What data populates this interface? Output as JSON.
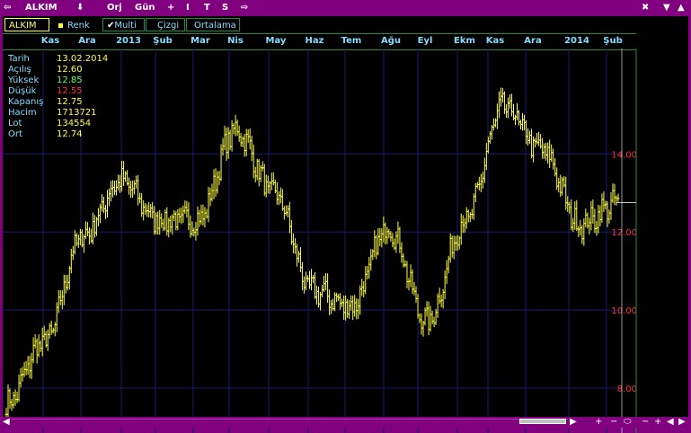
{
  "titlebar": {
    "symbol": "ALKIM",
    "orj": "Orj",
    "period": "Gün",
    "i": "I",
    "t": "T",
    "s": "S",
    "plus": "+"
  },
  "tabs": [
    {
      "label": "ALKIM"
    },
    {
      "label": "Renk"
    },
    {
      "label": "Multi"
    },
    {
      "label": "Çizgi"
    },
    {
      "label": "Ortalama"
    }
  ],
  "months": [
    "Kas",
    "Ara",
    "2013",
    "Şub",
    "Mar",
    "Nis",
    "May",
    "Haz",
    "Tem",
    "Ağu",
    "Eyl",
    "Ekm",
    "Kas",
    "Ara",
    "2014",
    "Şub"
  ],
  "info": [
    {
      "label": "Tarih",
      "value": "13.02.2014",
      "color": "#ffff44"
    },
    {
      "label": "Açılış",
      "value": "12.60",
      "color": "#ffff44"
    },
    {
      "label": "Yüksek",
      "value": "12.85",
      "color": "#66ff66"
    },
    {
      "label": "Düşük",
      "value": "12.55",
      "color": "#ff3333"
    },
    {
      "label": "Kapanış",
      "value": "12.75",
      "color": "#ffff44"
    },
    {
      "label": "Hacim",
      "value": "1713721",
      "color": "#ffff44"
    },
    {
      "label": "Lot",
      "value": "134554",
      "color": "#ffff44"
    },
    {
      "label": "Ort",
      "value": "12.74",
      "color": "#ffff44"
    }
  ],
  "colors": {
    "background": "#000000",
    "bars": "#ffff44",
    "axis_labels": "#ff3333",
    "grid": "#1a1a70",
    "frame": "#800080"
  },
  "chart_data": {
    "type": "bar",
    "subtype": "ohlc",
    "title": "ALKIM",
    "period": "daily",
    "ylim": [
      6.85,
      16.7
    ],
    "y_ticks": [
      "8.00",
      "10.00",
      "12.00",
      "14.00"
    ],
    "grid": true,
    "x_tick_labels": [
      "Kas",
      "Ara",
      "2013",
      "Şub",
      "Mar",
      "Nis",
      "May",
      "Haz",
      "Tem",
      "Ağu",
      "Eyl",
      "Ekm",
      "Kas",
      "Ara",
      "2014",
      "Şub"
    ],
    "series": [
      {
        "name": "ALKIM",
        "closes": [
          {
            "x": "Ekm 2012",
            "close": 7.6
          },
          {
            "x": "Kas 2012",
            "close": 9.2
          },
          {
            "x": "Ara 2012",
            "close": 11.9
          },
          {
            "x": "Oca 2013",
            "close": 13.3
          },
          {
            "x": "Şub 2013",
            "close": 12.3
          },
          {
            "x": "Mar 2013",
            "close": 12.3
          },
          {
            "x": "Nis 2013",
            "close": 14.6
          },
          {
            "x": "May 2013",
            "close": 13.0
          },
          {
            "x": "Haz 2013",
            "close": 10.5
          },
          {
            "x": "Tem 2013",
            "close": 10.1
          },
          {
            "x": "Ağu 2013",
            "close": 12.1
          },
          {
            "x": "Eyl 2013",
            "close": 9.7
          },
          {
            "x": "Ekm 2013",
            "close": 12.3
          },
          {
            "x": "Kas 2013",
            "close": 15.2
          },
          {
            "x": "Ara 2013",
            "close": 14.1
          },
          {
            "x": "Oca 2014",
            "close": 12.2
          },
          {
            "x": "Şub 2014",
            "close": 12.75
          }
        ],
        "last_bar": {
          "date": "13.02.2014",
          "open": 12.6,
          "high": 12.85,
          "low": 12.55,
          "close": 12.75
        }
      }
    ]
  }
}
